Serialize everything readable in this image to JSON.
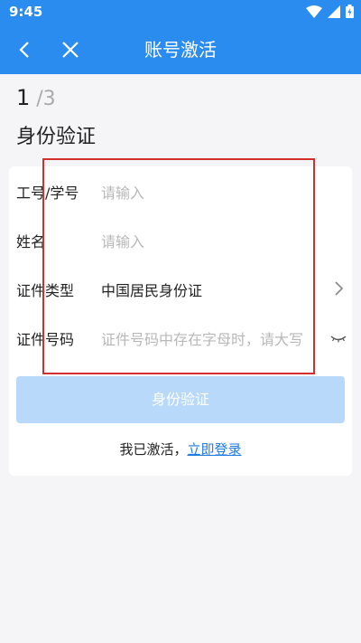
{
  "status_bar": {
    "time": "9:45"
  },
  "nav": {
    "title": "账号激活",
    "back_icon": "chevron-left-icon",
    "close_icon": "close-icon"
  },
  "step": {
    "current": "1",
    "total": " /3"
  },
  "section_title": "身份验证",
  "form": {
    "employee_id": {
      "label": "工号/学号",
      "placeholder": "请输入"
    },
    "name": {
      "label": "姓名",
      "placeholder": "请输入"
    },
    "id_type": {
      "label": "证件类型",
      "value": "中国居民身份证"
    },
    "id_number": {
      "label": "证件号码",
      "placeholder": "证件号码中存在字母时，请大写"
    }
  },
  "verify_button": "身份验证",
  "login": {
    "text": "我已激活，",
    "link": "立即登录"
  },
  "colors": {
    "primary": "#2b8cf0",
    "button_disabled": "#b9d9fb",
    "link": "#1f7ae0",
    "highlight": "#d32f2f"
  }
}
